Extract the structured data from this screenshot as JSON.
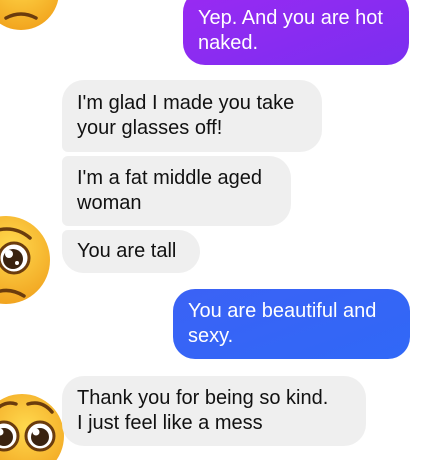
{
  "conversation": {
    "messages": [
      {
        "sender": "me",
        "text": "Yep. And you are hot\nnaked."
      },
      {
        "sender": "them",
        "text": "I'm glad I made you take\nyour glasses off!"
      },
      {
        "sender": "them",
        "text": "I'm a fat middle aged\nwoman"
      },
      {
        "sender": "them",
        "text": "You are tall"
      },
      {
        "sender": "me",
        "text": "You are  beautiful and\nsexy."
      },
      {
        "sender": "them",
        "text": "Thank you for being so kind.\nI just feel like a mess"
      }
    ]
  },
  "colors": {
    "outgoing_purple": "#8a2cf1",
    "outgoing_blue": "#3467f6",
    "incoming_bubble": "#efefef",
    "emoji_face": "#f6b928"
  },
  "icons": {
    "avatar_emoji": "pleading-face-emoji",
    "top_emoji": "sad-face-emoji"
  }
}
